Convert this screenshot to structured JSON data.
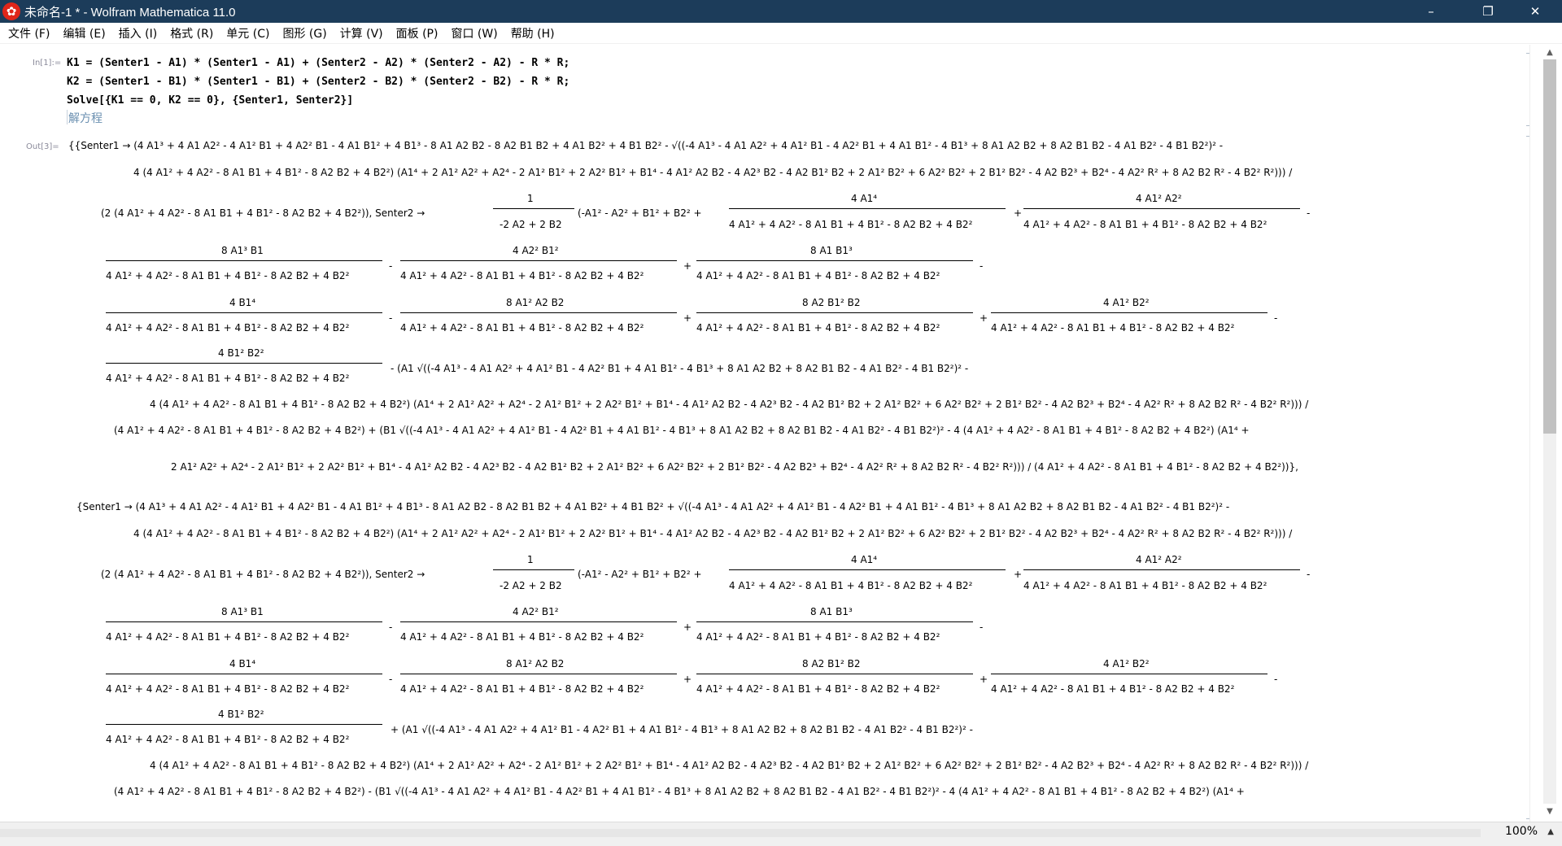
{
  "window": {
    "title": "未命名-1 * - Wolfram Mathematica 11.0",
    "app_icon": "✿",
    "minimize": "–",
    "restore": "❐",
    "close": "✕"
  },
  "menu": [
    "文件 (F)",
    "编辑 (E)",
    "插入 (I)",
    "格式 (R)",
    "单元 (C)",
    "图形 (G)",
    "计算 (V)",
    "面板 (P)",
    "窗口 (W)",
    "帮助 (H)"
  ],
  "notebook": {
    "in_label": "In[1]:=",
    "out_label": "Out[3]=",
    "input_lines": [
      "K1 = (Senter1 - A1) * (Senter1 - A1) + (Senter2 - A2) * (Senter2 - A2) - R * R;",
      "K2 = (Senter1 - B1) * (Senter1 - B1) + (Senter2 - B2) * (Senter2 - B2) - R * R;",
      "Solve[{K1 == 0, K2 == 0}, {Senter1, Senter2}]"
    ],
    "suggestion": "解方程",
    "output_lines": [
      "{{Senter1 → (4 A1³ + 4 A1 A2² - 4 A1² B1 + 4 A2² B1 - 4 A1 B1² + 4 B1³ - 8 A1 A2 B2 - 8 A2 B1 B2 + 4 A1 B2² + 4 B1 B2² - √((-4 A1³ - 4 A1 A2² + 4 A1² B1 - 4 A2² B1 + 4 A1 B1² - 4 B1³ + 8 A1 A2 B2 + 8 A2 B1 B2 - 4 A1 B2² - 4 B1 B2²)² -",
      "4 (4 A1² + 4 A2² - 8 A1 B1 + 4 B1² - 8 A2 B2 + 4 B2²) (A1⁴ + 2 A1² A2² + A2⁴ - 2 A1² B1² + 2 A2² B1² + B1⁴ - 4 A1² A2 B2 - 4 A2³ B2 - 4 A2 B1² B2 + 2 A1² B2² + 6 A2² B2² + 2 B1² B2² - 4 A2 B2³ + B2⁴ - 4 A2² R² + 8 A2 B2 R² - 4 B2² R²))) /",
      "(2 (4 A1² + 4 A2² - 8 A1 B1 + 4 B1² - 8 A2 B2 + 4 B2²)), Senter2 →",
      "- (A1 √((-4 A1³ - 4 A1 A2² + 4 A1² B1 - 4 A2² B1 + 4 A1 B1² - 4 B1³ + 8 A1 A2 B2 + 8 A2 B1 B2 - 4 A1 B2² - 4 B1 B2²)² -",
      "4 (4 A1² + 4 A2² - 8 A1 B1 + 4 B1² - 8 A2 B2 + 4 B2²) (A1⁴ + 2 A1² A2² + A2⁴ - 2 A1² B1² + 2 A2² B1² + B1⁴ - 4 A1² A2 B2 - 4 A2³ B2 - 4 A2 B1² B2 + 2 A1² B2² + 6 A2² B2² + 2 B1² B2² - 4 A2 B2³ + B2⁴ - 4 A2² R² + 8 A2 B2 R² - 4 B2² R²))) /",
      "(4 A1² + 4 A2² - 8 A1 B1 + 4 B1² - 8 A2 B2 + 4 B2²) + (B1 √((-4 A1³ - 4 A1 A2² + 4 A1² B1 - 4 A2² B1 + 4 A1 B1² - 4 B1³ + 8 A1 A2 B2 + 8 A2 B1 B2 - 4 A1 B2² - 4 B1 B2²)² - 4 (4 A1² + 4 A2² - 8 A1 B1 + 4 B1² - 8 A2 B2 + 4 B2²) (A1⁴ +",
      "2 A1² A2² + A2⁴ - 2 A1² B1² + 2 A2² B1² + B1⁴ - 4 A1² A2 B2 - 4 A2³ B2 - 4 A2 B1² B2 + 2 A1² B2² + 6 A2² B2² + 2 B1² B2² - 4 A2 B2³ + B2⁴ - 4 A2² R² + 8 A2 B2 R² - 4 B2² R²))) / (4 A1² + 4 A2² - 8 A1 B1 + 4 B1² - 8 A2 B2 + 4 B2²))},",
      "{Senter1 → (4 A1³ + 4 A1 A2² - 4 A1² B1 + 4 A2² B1 - 4 A1 B1² + 4 B1³ - 8 A1 A2 B2 - 8 A2 B1 B2 + 4 A1 B2² + 4 B1 B2² + √((-4 A1³ - 4 A1 A2² + 4 A1² B1 - 4 A2² B1 + 4 A1 B1² - 4 B1³ + 8 A1 A2 B2 + 8 A2 B1 B2 - 4 A1 B2² - 4 B1 B2²)² -",
      "+ (A1 √((-4 A1³ - 4 A1 A2² + 4 A1² B1 - 4 A2² B1 + 4 A1 B1² - 4 B1³ + 8 A1 A2 B2 + 8 A2 B1 B2 - 4 A1 B2² - 4 B1 B2²)² -",
      "(4 A1² + 4 A2² - 8 A1 B1 + 4 B1² - 8 A2 B2 + 4 B2²) - (B1 √((-4 A1³ - 4 A1 A2² + 4 A1² B1 - 4 A2² B1 + 4 A1 B1² - 4 B1³ + 8 A1 A2 B2 + 8 A2 B1 B2 - 4 A1 B2² - 4 B1 B2²)² - 4 (4 A1² + 4 A2² - 8 A1 B1 + 4 B1² - 8 A2 B2 + 4 B2²) (A1⁴ +"
    ],
    "denominator": "4 A1² + 4 A2² - 8 A1 B1 + 4 B1² - 8 A2 B2 + 4 B2²",
    "senter2_frac": {
      "num": "1",
      "den": "-2 A2 + 2 B2",
      "tail": "(-A1² - A2² + B1² + B2² +"
    },
    "numerators": [
      "4 A1⁴",
      "4 A1² A2²",
      "8 A1³ B1",
      "4 A2² B1²",
      "8 A1 B1³",
      "4 B1⁴",
      "8 A1² A2 B2",
      "8 A2 B1² B2",
      "4 A1² B2²",
      "4 B1² B2²"
    ],
    "ops": [
      "+",
      "-",
      "-",
      "+",
      "-",
      "-",
      "+",
      "+",
      "-"
    ]
  },
  "statusbar": {
    "zoom": "100%",
    "zoom_arrow": "▲"
  },
  "scrollbar": {
    "up": "▲",
    "down": "▼"
  }
}
